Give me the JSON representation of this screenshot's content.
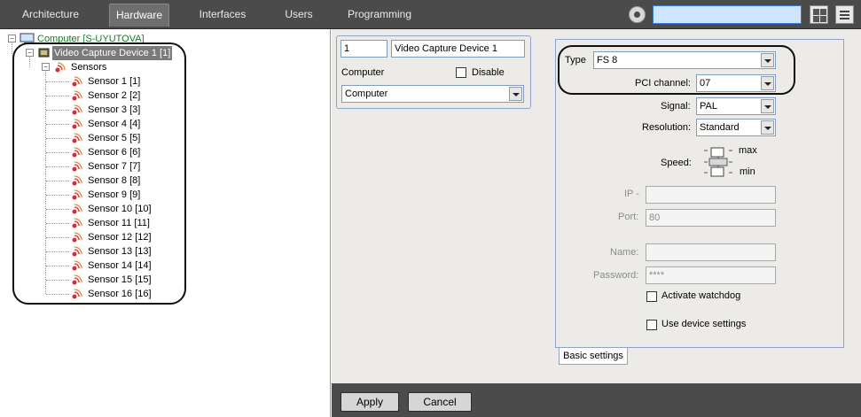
{
  "topbar": {
    "tabs": [
      {
        "label": "Architecture",
        "active": false
      },
      {
        "label": "Hardware",
        "active": true
      },
      {
        "label": "Interfaces",
        "active": false
      },
      {
        "label": "Users",
        "active": false
      },
      {
        "label": "Programming",
        "active": false
      }
    ],
    "search_value": "",
    "icons": [
      "settings-icon",
      "layout-grid-icon",
      "menu-icon"
    ]
  },
  "tree": {
    "root": {
      "label": "Computer [S-UYUTOVA]",
      "color": "#1a7a2a",
      "icon": "computer-icon"
    },
    "device": {
      "label": "Video Capture Device 1 [1]",
      "icon": "capture-card-icon"
    },
    "sensors_group": {
      "label": "Sensors",
      "icon": "sensor-icon"
    },
    "sensors": [
      "Sensor 1 [1]",
      "Sensor 2 [2]",
      "Sensor 3 [3]",
      "Sensor 4 [4]",
      "Sensor 5 [5]",
      "Sensor 6 [6]",
      "Sensor 7 [7]",
      "Sensor 8 [8]",
      "Sensor 9 [9]",
      "Sensor 10 [10]",
      "Sensor 11 [11]",
      "Sensor 12 [12]",
      "Sensor 13 [13]",
      "Sensor 14 [14]",
      "Sensor 15 [15]",
      "Sensor 16 [16]"
    ]
  },
  "object": {
    "id_value": "1",
    "name_value": "Video Capture Device 1",
    "parent_label": "Computer",
    "disable_label": "Disable",
    "disable_checked": false,
    "parent_value": "Computer"
  },
  "settings": {
    "type_label": "Type",
    "type_value": "FS 8",
    "pci_label": "PCI channel:",
    "pci_value": "07",
    "signal_label": "Signal:",
    "signal_value": "PAL",
    "resolution_label": "Resolution:",
    "resolution_value": "Standard",
    "speed_label": "Speed:",
    "speed_max": "max",
    "speed_min": "min",
    "ip_label": "IP -",
    "ip_value": "",
    "port_label": "Port:",
    "port_value": "80",
    "name_label": "Name:",
    "name_value": "",
    "password_label": "Password:",
    "password_value": "****",
    "watchdog_label": "Activate watchdog",
    "watchdog_checked": false,
    "device_settings_label": "Use device settings",
    "device_settings_checked": false,
    "tab_label": "Basic settings"
  },
  "footer": {
    "apply_label": "Apply",
    "cancel_label": "Cancel"
  },
  "colors": {
    "topbar_bg": "#4b4b4b",
    "panel_bg": "#ecebe8",
    "search_bg": "#cfe4ff",
    "root_text": "#1a7a2a"
  }
}
